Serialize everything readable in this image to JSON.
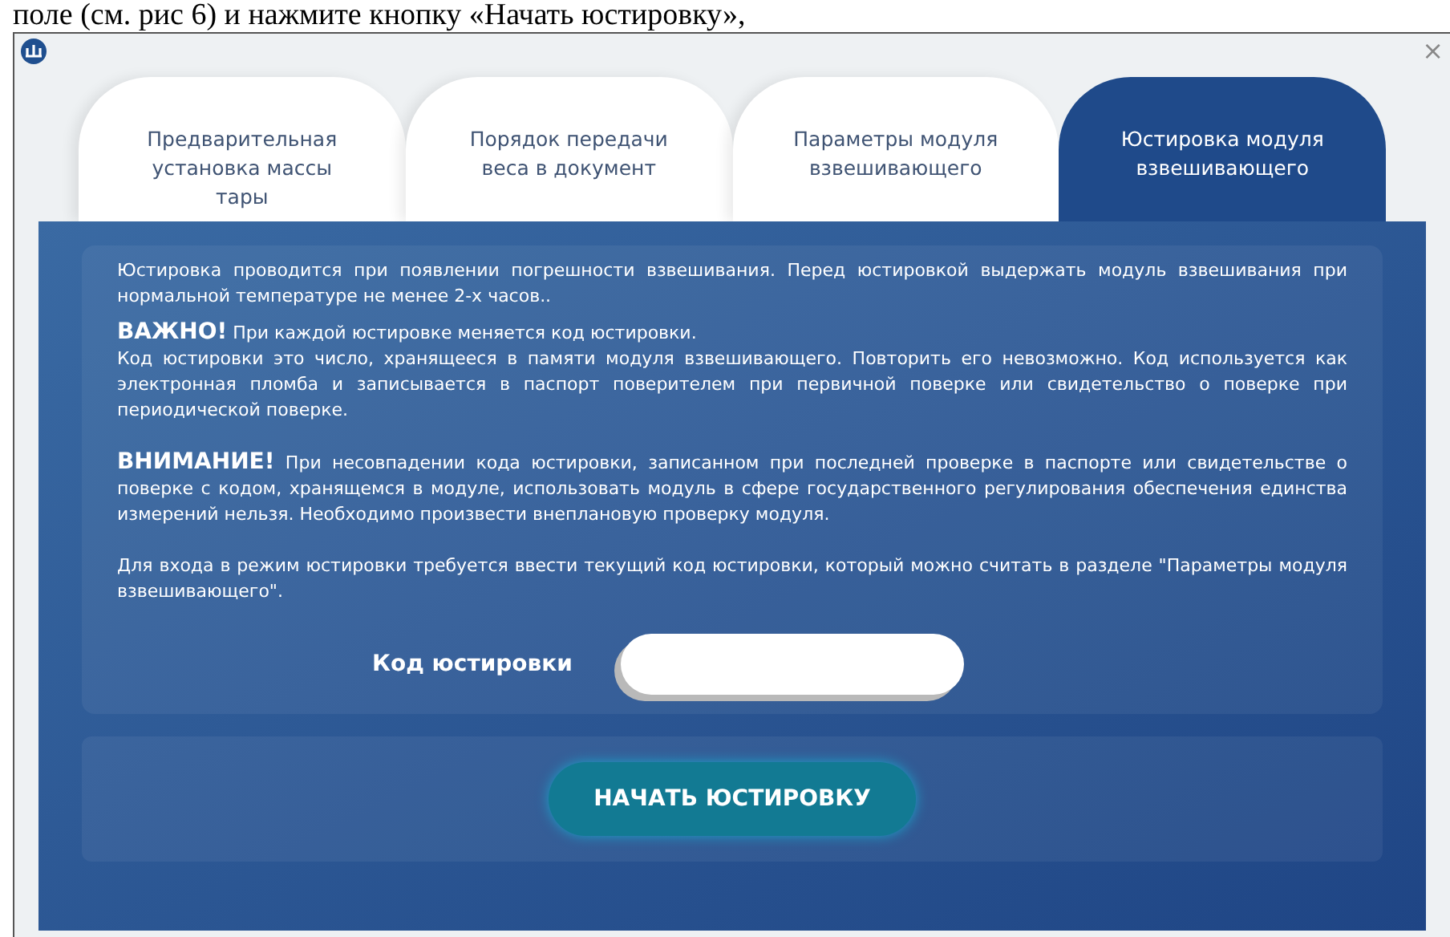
{
  "document_text": "поле (см. рис 6) и нажмите кнопку «Начать юстировку»,",
  "window": {
    "close": "×"
  },
  "tabs": [
    {
      "label": "Предварительная установка массы тары",
      "selected": false
    },
    {
      "label": "Порядок передачи веса в документ",
      "selected": false
    },
    {
      "label": "Параметры модуля взвешивающего",
      "selected": false
    },
    {
      "label": "Юстировка модуля взвешивающего",
      "selected": true
    }
  ],
  "info": {
    "paragraphs": [
      "Юстировка проводится при появлении погрешности взвешивания. Перед юстировкой выдержать модуль взвешивания при нормальной температуре не менее 2-х часов..",
      "**ВАЖНО!** При каждой юстировке меняется код юстировки.",
      "Код юстировки это число, хранящееся в памяти модуля взвешивающего. Повторить его невозможно. Код используется как электронная пломба и записывается в паспорт поверителем при первичной поверке или свидетельство о поверке при периодической поверке.",
      "**ВНИМАНИЕ!** При несовпадении кода юстировки, записанном при последней проверке в паспорте или свидетельстве о поверке с кодом, хранящемся в модуле, использовать модуль в сфере государственного регулирования обеспечения единства измерений нельзя. Необходимо произвести внеплановую проверку модуля.",
      "Для входа в режим юстировки требуется ввести текущий код юстировки, который можно считать в разделе \"Параметры модуля взвешивающего\"."
    ],
    "code_label": "Код юстировки"
  },
  "start_button": "НАЧАТЬ ЮСТИРОВКУ"
}
